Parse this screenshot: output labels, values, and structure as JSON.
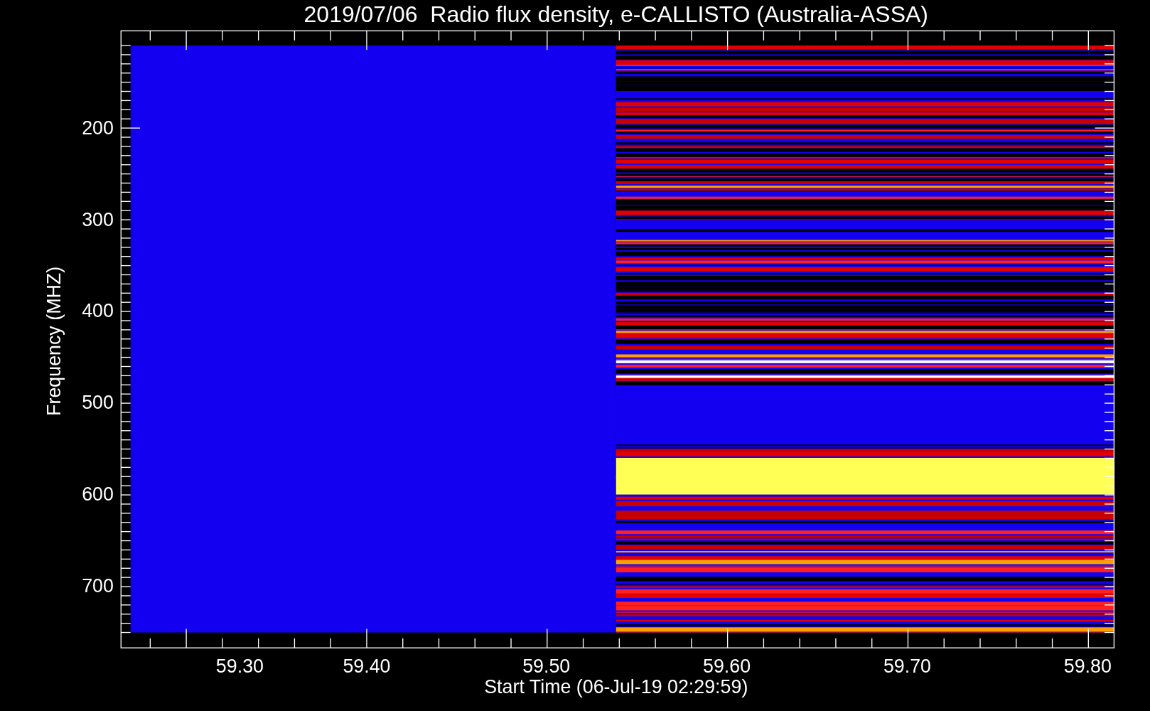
{
  "title": "2019/07/06  Radio flux density, e-CALLISTO (Australia-ASSA)",
  "x_axis": {
    "label": "Start Time (06-Jul-19 02:29:59)",
    "ticks": [
      "59.30",
      "59.40",
      "59.50",
      "59.60",
      "59.70",
      "59.80"
    ]
  },
  "y_axis": {
    "label": "Frequency (MHZ)",
    "ticks": [
      "200",
      "300",
      "400",
      "500",
      "600",
      "700"
    ]
  }
}
